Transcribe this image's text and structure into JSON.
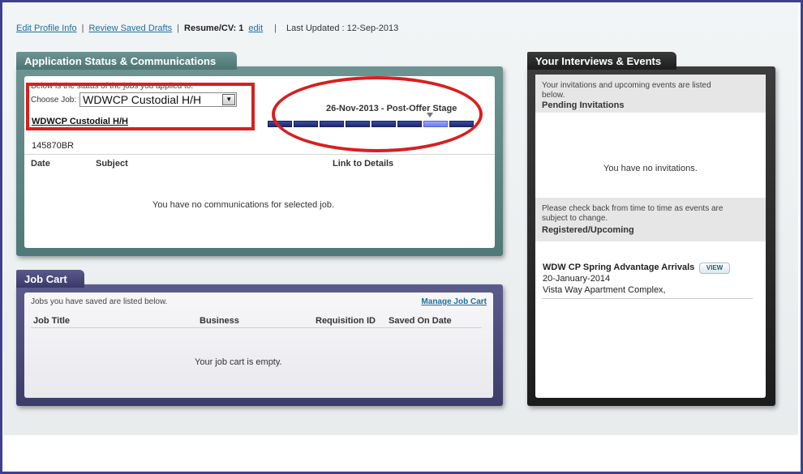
{
  "topbar": {
    "edit_profile": "Edit Profile Info",
    "sep1": "|",
    "review_drafts": "Review Saved Drafts",
    "sep2": "|",
    "resume_label": "Resume/CV: 1",
    "edit": "edit",
    "sep3": "|",
    "last_updated": "Last Updated : 12-Sep-2013"
  },
  "app_status": {
    "title": "Application Status & Communications",
    "hint": "Below is the status of the jobs you applied to.",
    "choose_label": "Choose Job:",
    "selected_job": "WDWCP Custodial H/H",
    "dropdown_arrow": "▼",
    "job_link": "WDWCP Custodial H/H",
    "requisition": "145870BR",
    "stage": "26-Nov-2013 - Post-Offer Stage",
    "stage_segments": 8,
    "stage_active_index": 6,
    "columns": [
      "Date",
      "Subject",
      "Link to Details"
    ],
    "empty": "You have no communications for selected job."
  },
  "job_cart": {
    "title": "Job Cart",
    "hint": "Jobs you have saved are listed below.",
    "manage": "Manage Job Cart",
    "columns": [
      "Job Title",
      "Business",
      "Requisition ID",
      "Saved On Date"
    ],
    "empty": "Your job cart is empty."
  },
  "interviews": {
    "title": "Your Interviews & Events",
    "intro": "Your invitations and upcoming events are listed below.",
    "pending_heading": "Pending Invitations",
    "no_invites": "You have no invitations.",
    "check_back": "Please check back from time to time as events are subject to change.",
    "registered_heading": "Registered/Upcoming",
    "event": {
      "title": "WDW CP Spring Advantage Arrivals",
      "view": "VIEW",
      "date": "20-January-2014",
      "location": "Vista Way Apartment Complex,"
    }
  },
  "colors": {
    "annotation_red": "#d81f1f",
    "link_blue": "#1d6f9e",
    "app_panel": "#5a8584",
    "cart_panel": "#4a4a7a",
    "interviews_panel": "#2a2a2a"
  }
}
